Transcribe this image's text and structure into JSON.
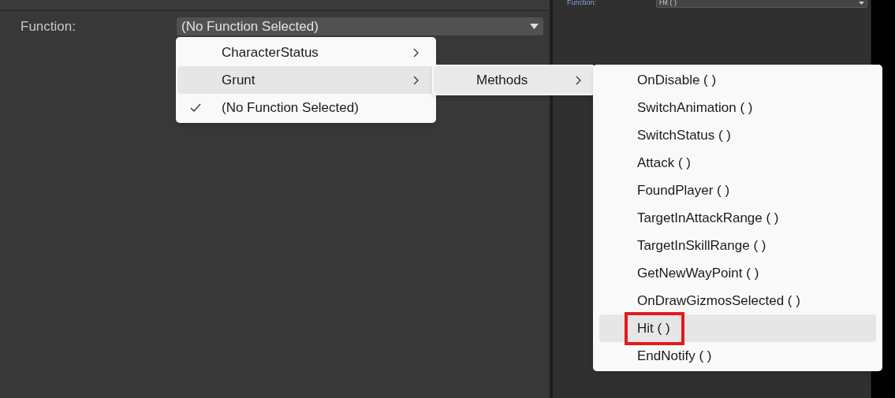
{
  "left_panel": {
    "label": "Function:",
    "value": "(No Function Selected)"
  },
  "right_panel": {
    "label": "Function:",
    "value": "Hit ( )"
  },
  "menu": [
    {
      "label": "CharacterStatus",
      "submenu": true,
      "checked": false,
      "selected": false
    },
    {
      "label": "Grunt",
      "submenu": true,
      "checked": false,
      "selected": true
    },
    {
      "label": "(No Function Selected)",
      "submenu": false,
      "checked": true,
      "selected": false
    }
  ],
  "submenu": [
    {
      "label": "Methods",
      "submenu": true,
      "selected": true
    }
  ],
  "methods": [
    {
      "label": "OnDisable ( )",
      "selected": false,
      "annotated": false
    },
    {
      "label": "SwitchAnimation ( )",
      "selected": false,
      "annotated": false
    },
    {
      "label": "SwitchStatus ( )",
      "selected": false,
      "annotated": false
    },
    {
      "label": "Attack ( )",
      "selected": false,
      "annotated": false
    },
    {
      "label": "FoundPlayer ( )",
      "selected": false,
      "annotated": false
    },
    {
      "label": "TargetInAttackRange ( )",
      "selected": false,
      "annotated": false
    },
    {
      "label": "TargetInSkillRange ( )",
      "selected": false,
      "annotated": false
    },
    {
      "label": "GetNewWayPoint ( )",
      "selected": false,
      "annotated": false
    },
    {
      "label": "OnDrawGizmosSelected ( )",
      "selected": false,
      "annotated": false
    },
    {
      "label": "Hit ( )",
      "selected": true,
      "annotated": true
    },
    {
      "label": "EndNotify ( )",
      "selected": false,
      "annotated": false
    }
  ]
}
